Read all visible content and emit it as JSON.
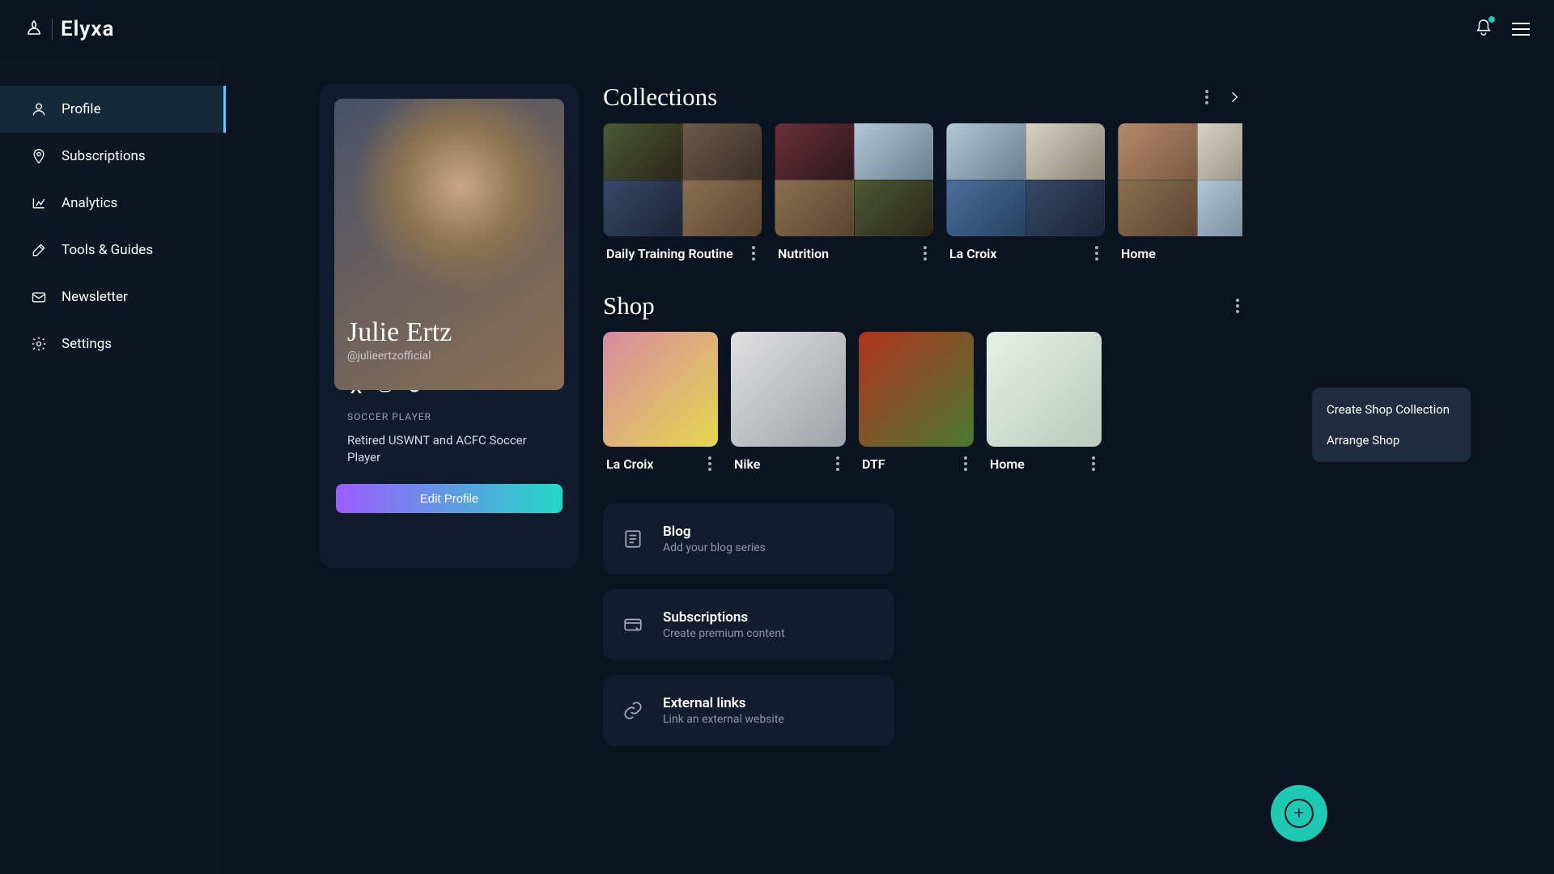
{
  "brand": "Elyxa",
  "sidebar": {
    "items": [
      {
        "label": "Profile",
        "active": true
      },
      {
        "label": "Subscriptions"
      },
      {
        "label": "Analytics"
      },
      {
        "label": "Tools & Guides"
      },
      {
        "label": "Newsletter"
      },
      {
        "label": "Settings"
      }
    ]
  },
  "profile": {
    "name": "Julie Ertz",
    "handle": "@julieertzofficial",
    "role": "SOCCER PLAYER",
    "bio": "Retired USWNT and ACFC Soccer Player",
    "edit_label": "Edit Profile"
  },
  "collections": {
    "title": "Collections",
    "items": [
      {
        "label": "Daily Training Routine"
      },
      {
        "label": "Nutrition"
      },
      {
        "label": "La Croix"
      },
      {
        "label": "Home"
      }
    ]
  },
  "shop": {
    "title": "Shop",
    "items": [
      {
        "label": "La Croix"
      },
      {
        "label": "Nike"
      },
      {
        "label": "DTF"
      },
      {
        "label": "Home"
      }
    ],
    "menu": [
      "Create Shop Collection",
      "Arrange Shop"
    ]
  },
  "add_cards": [
    {
      "title": "Blog",
      "sub": "Add your blog series"
    },
    {
      "title": "Subscriptions",
      "sub": "Create premium content"
    },
    {
      "title": "External links",
      "sub": "Link an external website"
    }
  ]
}
